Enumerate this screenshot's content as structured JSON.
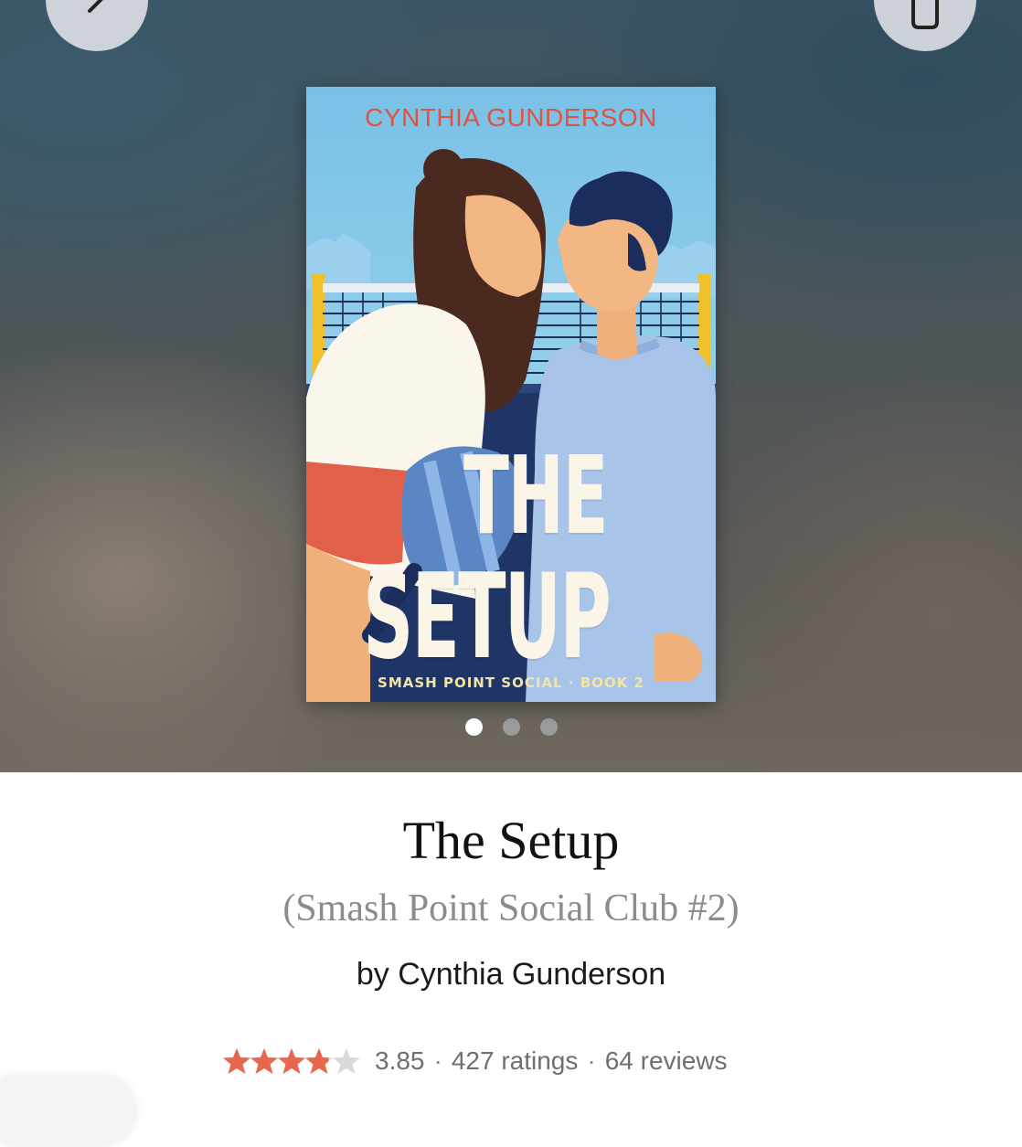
{
  "header": {
    "back_icon": "chevron-left-icon",
    "share_icon": "share-icon"
  },
  "cover": {
    "author": "CYNTHIA GUNDERSON",
    "title_line1": "THE",
    "title_line2": "SETUP",
    "series": "SMASH POINT SOCIAL · BOOK 2"
  },
  "carousel": {
    "page_count": 3,
    "active_index": 0
  },
  "book": {
    "title": "The Setup",
    "series": "(Smash Point Social Club #2)",
    "author": "by Cynthia Gunderson",
    "rating_stars": 3.85,
    "rating": "3.85",
    "ratings": "427 ratings",
    "reviews": "64 reviews",
    "separator": "·"
  },
  "colors": {
    "star": "#e8664e",
    "star_empty": "#d9d9d9"
  }
}
